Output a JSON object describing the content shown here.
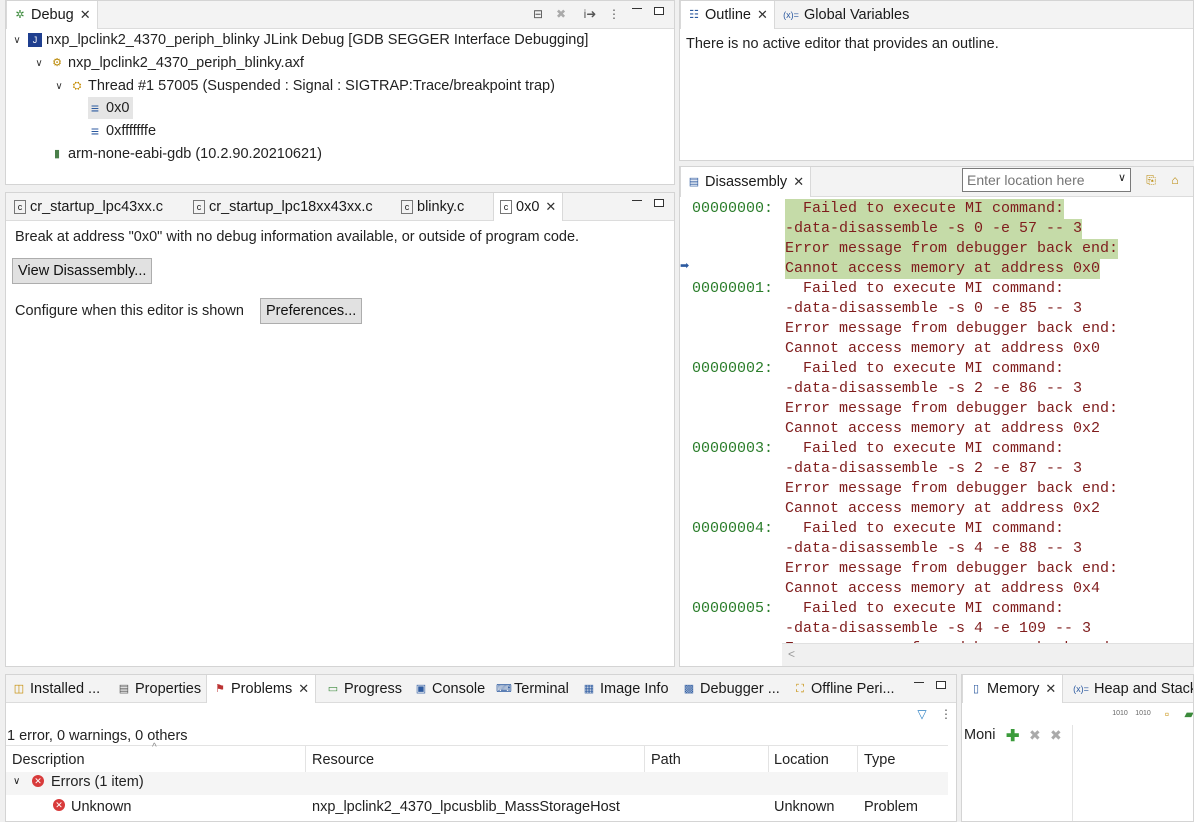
{
  "debug": {
    "tab": "Debug",
    "rows": [
      {
        "text": "nxp_lpclink2_4370_periph_blinky JLink Debug [GDB SEGGER Interface Debugging]"
      },
      {
        "text": "nxp_lpclink2_4370_periph_blinky.axf"
      },
      {
        "text": "Thread #1 57005 (Suspended : Signal : SIGTRAP:Trace/breakpoint trap)"
      },
      {
        "text": "0x0"
      },
      {
        "text": "0xfffffffe"
      },
      {
        "text": "arm-none-eabi-gdb (10.2.90.20210621)"
      }
    ]
  },
  "outline": {
    "tabs": [
      {
        "label": "Outline"
      },
      {
        "label": "Global Variables"
      }
    ],
    "message": "There is no active editor that provides an outline."
  },
  "editor": {
    "tabs": [
      {
        "label": "cr_startup_lpc43xx.c"
      },
      {
        "label": "cr_startup_lpc18xx43xx.c"
      },
      {
        "label": "blinky.c"
      },
      {
        "label": "0x0"
      }
    ],
    "message": "Break at address \"0x0\" with no debug information available, or outside of program code.",
    "view_disassembly": "View Disassembly...",
    "configure_label": "Configure when this editor is shown",
    "preferences": "Preferences..."
  },
  "disassembly": {
    "tab": "Disassembly",
    "location_placeholder": "Enter location here",
    "entries": [
      {
        "addr": "00000000:",
        "lines": [
          "  Failed to execute MI command:",
          "-data-disassemble -s 0 -e 57 -- 3",
          "Error message from debugger back end:",
          "Cannot access memory at address 0x0"
        ],
        "highlight": true
      },
      {
        "addr": "00000001:",
        "lines": [
          "  Failed to execute MI command:",
          "-data-disassemble -s 0 -e 85 -- 3",
          "Error message from debugger back end:",
          "Cannot access memory at address 0x0"
        ],
        "highlight": false
      },
      {
        "addr": "00000002:",
        "lines": [
          "  Failed to execute MI command:",
          "-data-disassemble -s 2 -e 86 -- 3",
          "Error message from debugger back end:",
          "Cannot access memory at address 0x2"
        ],
        "highlight": false
      },
      {
        "addr": "00000003:",
        "lines": [
          "  Failed to execute MI command:",
          "-data-disassemble -s 2 -e 87 -- 3",
          "Error message from debugger back end:",
          "Cannot access memory at address 0x2"
        ],
        "highlight": false
      },
      {
        "addr": "00000004:",
        "lines": [
          "  Failed to execute MI command:",
          "-data-disassemble -s 4 -e 88 -- 3",
          "Error message from debugger back end:",
          "Cannot access memory at address 0x4"
        ],
        "highlight": false
      },
      {
        "addr": "00000005:",
        "lines": [
          "  Failed to execute MI command:",
          "-data-disassemble -s 4 -e 109 -- 3",
          "Error message from debugger back end:"
        ],
        "highlight": false
      }
    ]
  },
  "bottom": {
    "tabs": [
      {
        "label": "Installed ..."
      },
      {
        "label": "Properties"
      },
      {
        "label": "Problems"
      },
      {
        "label": "Progress"
      },
      {
        "label": "Console"
      },
      {
        "label": "Terminal"
      },
      {
        "label": "Image Info"
      },
      {
        "label": "Debugger ..."
      },
      {
        "label": "Offline Peri..."
      }
    ],
    "summary": "1 error, 0 warnings, 0 others",
    "columns": [
      "Description",
      "Resource",
      "Path",
      "Location",
      "Type"
    ],
    "group": "Errors (1 item)",
    "row": {
      "description": "Unknown",
      "resource": "nxp_lpclink2_4370_lpcusblib_MassStorageHost",
      "path": "",
      "location": "Unknown",
      "type": "Problem"
    }
  },
  "memory": {
    "tabs": [
      {
        "label": "Memory"
      },
      {
        "label": "Heap and Stack"
      }
    ],
    "monitors_label": "Moni"
  },
  "colors": {
    "highlight_bg": "#c5dba8",
    "addr_green": "#2a7d2a",
    "error_red": "#7f1c1c",
    "selection_bg": "#e5e5e5"
  }
}
